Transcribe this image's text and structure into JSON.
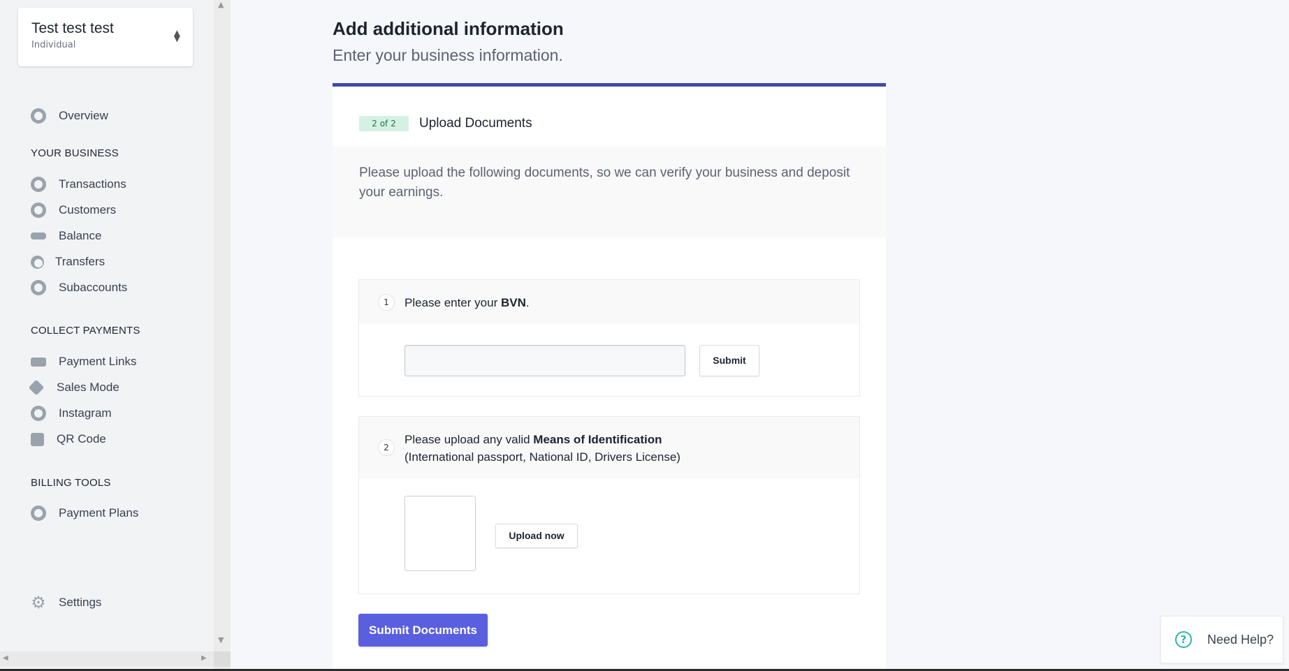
{
  "account": {
    "name": "Test test test",
    "type": "Individual"
  },
  "nav": {
    "overview": "Overview",
    "sections": {
      "business": "YOUR BUSINESS",
      "collect": "COLLECT PAYMENTS",
      "billing": "BILLING TOOLS"
    },
    "business_items": [
      "Transactions",
      "Customers",
      "Balance",
      "Transfers",
      "Subaccounts"
    ],
    "collect_items": [
      "Payment Links",
      "Sales Mode",
      "Instagram",
      "QR Code"
    ],
    "billing_items": [
      "Payment Plans"
    ],
    "settings": "Settings"
  },
  "page": {
    "title": "Add additional information",
    "subtitle": "Enter your business information.",
    "progress": 1.0
  },
  "step": {
    "badge": "2 of 2",
    "title": "Upload Documents",
    "intro": "Please upload the following documents, so we can verify your business and deposit your earnings."
  },
  "requirements": [
    {
      "num": "1",
      "text_before": "Please enter your ",
      "text_bold": "BVN",
      "text_after": ".",
      "input_value": "",
      "button": "Submit"
    },
    {
      "num": "2",
      "text_before": "Please upload any valid ",
      "text_bold": "Means of Identification",
      "text_line2": "(International passport, National ID, Drivers License)",
      "button": "Upload now"
    }
  ],
  "submit_documents": "Submit Documents",
  "help": {
    "label": "Need Help?",
    "icon": "question-icon"
  },
  "colors": {
    "accent": "#3f4aa8",
    "primary_button": "#5a5fe0",
    "badge_bg": "#d5f1e4",
    "help": "#2bb5ad"
  }
}
